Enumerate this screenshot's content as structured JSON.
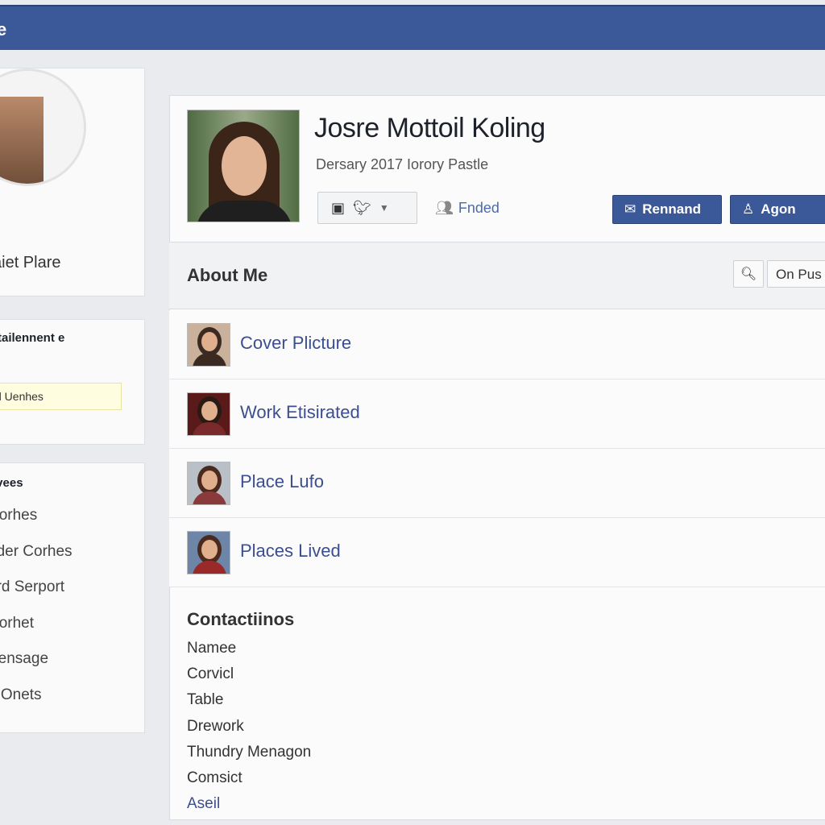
{
  "topbar": {
    "title": "e"
  },
  "left": {
    "profile_card": {
      "name": "aiet Plare"
    },
    "info_card": {
      "heading": "tailennent e",
      "note": "d Uenhes"
    },
    "list_card": {
      "heading": "ivees",
      "items": [
        "Corhes",
        "nder Corhes",
        "ard Serport",
        "Corhet",
        "Sensage",
        "e Onets"
      ]
    }
  },
  "profile": {
    "name": "Josre Mottoil Koling",
    "subtitle": "Dersary 2017 Iorory Pastle",
    "share_icons": [
      "camera-icon",
      "twitter-icon",
      "caret-down-icon"
    ],
    "friend_label": "Fnded",
    "buttons": {
      "remind": "Rennand",
      "agon": "Agon"
    }
  },
  "about": {
    "title": "About Me",
    "on_button": "On Pus",
    "rows": [
      {
        "label": "Cover Plicture"
      },
      {
        "label": "Work Etisirated"
      },
      {
        "label": "Place Lufo"
      },
      {
        "label": "Places Lived"
      }
    ]
  },
  "contacts": {
    "title": "Contactiinos",
    "items": [
      "Namee",
      "Corvicl",
      "Table",
      "Drework",
      "Thundry Menagon",
      "Comsict",
      "Aseil"
    ]
  },
  "colors": {
    "brand": "#3b5998",
    "link": "#3b4e8f",
    "background": "#e9ebee"
  }
}
